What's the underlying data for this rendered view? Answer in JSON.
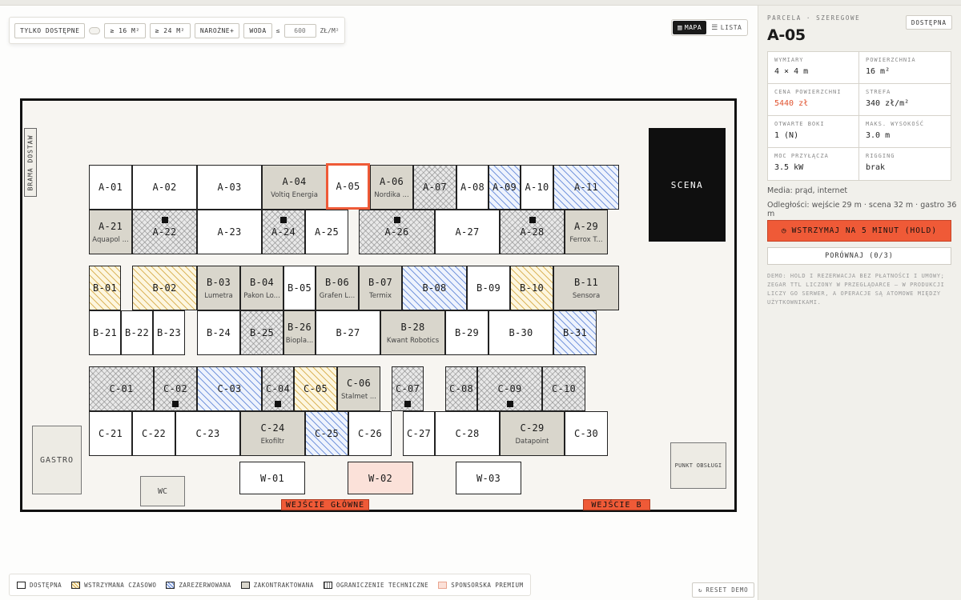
{
  "filters": {
    "only_available": "TYLKO DOSTĘPNE",
    "area16": "≥ 16 M²",
    "area24": "≥ 24 M²",
    "corner": "NAROŻNE+",
    "water": "WODA",
    "price_prefix": "≤",
    "price_placeholder": "600",
    "price_unit": "ZŁ/M²"
  },
  "view_toggle": {
    "map": "MAPA",
    "list": "LISTA",
    "active": "map"
  },
  "venue": {
    "gate": "BRAMA DOSTAW",
    "stage": "SCENA",
    "gastro": "GASTRO",
    "wc": "WC",
    "service": "PUNKT OBSŁUGI",
    "entrance_main": "WEJŚCIE GŁÓWNE",
    "entrance_b": "WEJŚCIE B"
  },
  "stalls": [
    {
      "id": "A-01",
      "status": "available"
    },
    {
      "id": "A-02",
      "status": "available"
    },
    {
      "id": "A-03",
      "status": "available"
    },
    {
      "id": "A-04",
      "status": "contracted",
      "company": "Voltiq Energia"
    },
    {
      "id": "A-05",
      "status": "available",
      "selected": true
    },
    {
      "id": "A-06",
      "status": "contracted",
      "company": "Nordika ..."
    },
    {
      "id": "A-07",
      "status": "technical"
    },
    {
      "id": "A-08",
      "status": "available"
    },
    {
      "id": "A-09",
      "status": "reserved"
    },
    {
      "id": "A-10",
      "status": "available"
    },
    {
      "id": "A-11",
      "status": "reserved"
    },
    {
      "id": "A-21",
      "status": "contracted",
      "company": "Aquapol ..."
    },
    {
      "id": "A-22",
      "status": "technical",
      "marker": "top"
    },
    {
      "id": "A-23",
      "status": "available"
    },
    {
      "id": "A-24",
      "status": "technical",
      "marker": "top"
    },
    {
      "id": "A-25",
      "status": "available"
    },
    {
      "id": "A-26",
      "status": "technical",
      "marker": "top"
    },
    {
      "id": "A-27",
      "status": "available"
    },
    {
      "id": "A-28",
      "status": "technical",
      "marker": "top"
    },
    {
      "id": "A-29",
      "status": "contracted",
      "company": "Ferrox T..."
    },
    {
      "id": "B-01",
      "status": "held"
    },
    {
      "id": "B-02",
      "status": "held"
    },
    {
      "id": "B-03",
      "status": "contracted",
      "company": "Lumetra"
    },
    {
      "id": "B-04",
      "status": "contracted",
      "company": "Pakon Lo..."
    },
    {
      "id": "B-05",
      "status": "available"
    },
    {
      "id": "B-06",
      "status": "contracted",
      "company": "Grafen L..."
    },
    {
      "id": "B-07",
      "status": "contracted",
      "company": "Termix"
    },
    {
      "id": "B-08",
      "status": "reserved"
    },
    {
      "id": "B-09",
      "status": "available"
    },
    {
      "id": "B-10",
      "status": "held"
    },
    {
      "id": "B-11",
      "status": "contracted",
      "company": "Sensora"
    },
    {
      "id": "B-21",
      "status": "available"
    },
    {
      "id": "B-22",
      "status": "available"
    },
    {
      "id": "B-23",
      "status": "available"
    },
    {
      "id": "B-24",
      "status": "available"
    },
    {
      "id": "B-25",
      "status": "technical"
    },
    {
      "id": "B-26",
      "status": "contracted",
      "company": "Biopla..."
    },
    {
      "id": "B-27",
      "status": "available"
    },
    {
      "id": "B-28",
      "status": "contracted",
      "company": "Kwant Robotics"
    },
    {
      "id": "B-29",
      "status": "available"
    },
    {
      "id": "B-30",
      "status": "available"
    },
    {
      "id": "B-31",
      "status": "reserved"
    },
    {
      "id": "C-01",
      "status": "technical"
    },
    {
      "id": "C-02",
      "status": "technical",
      "marker": "bottom"
    },
    {
      "id": "C-03",
      "status": "reserved"
    },
    {
      "id": "C-04",
      "status": "technical",
      "marker": "bottom"
    },
    {
      "id": "C-05",
      "status": "held"
    },
    {
      "id": "C-06",
      "status": "contracted",
      "company": "Stalmet ..."
    },
    {
      "id": "C-07",
      "status": "technical",
      "marker": "bottom"
    },
    {
      "id": "C-08",
      "status": "technical"
    },
    {
      "id": "C-09",
      "status": "technical",
      "marker": "bottom"
    },
    {
      "id": "C-10",
      "status": "technical"
    },
    {
      "id": "C-21",
      "status": "available"
    },
    {
      "id": "C-22",
      "status": "available"
    },
    {
      "id": "C-23",
      "status": "available"
    },
    {
      "id": "C-24",
      "status": "contracted",
      "company": "Ekofiltr"
    },
    {
      "id": "C-25",
      "status": "reserved"
    },
    {
      "id": "C-26",
      "status": "available"
    },
    {
      "id": "C-27",
      "status": "available"
    },
    {
      "id": "C-28",
      "status": "available"
    },
    {
      "id": "C-29",
      "status": "contracted",
      "company": "Datapoint"
    },
    {
      "id": "C-30",
      "status": "available"
    },
    {
      "id": "W-01",
      "status": "available"
    },
    {
      "id": "W-02",
      "status": "sponsor"
    },
    {
      "id": "W-03",
      "status": "available"
    }
  ],
  "legend": {
    "available": "DOSTĘPNA",
    "held": "WSTRZYMANA CZASOWO",
    "reserved": "ZAREZERWOWANA",
    "contracted": "ZAKONTRAKTOWANA",
    "technical": "OGRANICZENIE TECHNICZNE",
    "sponsor": "SPONSORSKA PREMIUM"
  },
  "reset": "RESET DEMO",
  "panel": {
    "kicker": "PARCELA · SZEREGOWE",
    "badge": "DOSTĘPNA",
    "title": "A-05",
    "details": [
      {
        "key": "WYMIARY",
        "value": "4 × 4 m"
      },
      {
        "key": "POWIERZCHNIA",
        "value": "16 m²"
      },
      {
        "key": "CENA POWIERZCHNI",
        "value": "5440 zł",
        "accent": true
      },
      {
        "key": "STREFA",
        "value": "340 zł/m²"
      },
      {
        "key": "OTWARTE BOKI",
        "value": "1 (N)"
      },
      {
        "key": "MAKS. WYSOKOŚĆ",
        "value": "3.0 m"
      },
      {
        "key": "MOC PRZYŁĄCZA",
        "value": "3.5 kW"
      },
      {
        "key": "RIGGING",
        "value": "brak"
      }
    ],
    "media": "Media: prąd, internet",
    "distances": "Odległości: wejście 29 m · scena 32 m · gastro 36 m",
    "hold_button": "WSTRZYMAJ NA 5 MINUT (HOLD)",
    "compare_button": "PORÓWNAJ (0/3)",
    "note": "DEMO: HOLD I REZERWACJA BEZ PŁATNOŚCI I UMOWY; ZEGAR TTL LICZONY W PRZEGLĄDARCE — W PRODUKCJI LICZY GO SERWER, A OPERACJE SĄ ATOMOWE MIĘDZY UŻYTKOWNIKAMI."
  },
  "colors": {
    "accent": "#ef5a37",
    "ink": "#111111",
    "contracted": "#d9d6cc",
    "reserved": "#5078d2",
    "held": "#d0a032",
    "sponsor": "#fbe1d9"
  }
}
